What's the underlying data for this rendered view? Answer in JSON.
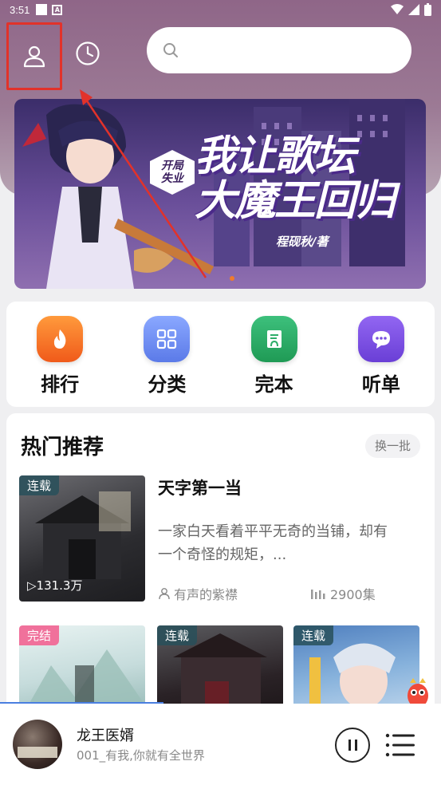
{
  "status_bar": {
    "time": "3:51"
  },
  "header": {
    "user_icon": "user-icon",
    "history_icon": "clock-icon",
    "search": {
      "placeholder": "",
      "icon": "search-icon"
    }
  },
  "banner": {
    "tag": "开局\n失业",
    "title": "我让歌坛\n大魔王回归",
    "author": "程砚秋/著",
    "active_dot": 1
  },
  "menu": {
    "items": [
      {
        "label": "排行",
        "icon": "flame-icon",
        "color": "#f47a26"
      },
      {
        "label": "分类",
        "icon": "grid-icon",
        "color": "#6f8ff0"
      },
      {
        "label": "完本",
        "icon": "book-headphones-icon",
        "color": "#2fae6a"
      },
      {
        "label": "听单",
        "icon": "chat-bubble-icon",
        "color": "#7a4fe0"
      }
    ]
  },
  "hot": {
    "title": "热门推荐",
    "swap_label": "换一批",
    "featured": {
      "tag": "连载",
      "plays": "▷131.3万",
      "title": "天字第一当",
      "description": "一家白天看着平平无奇的当铺，却有一个奇怪的规矩，...",
      "author": "有声的紫襟",
      "episodes": "2900集"
    },
    "more": [
      {
        "tag": "完结"
      },
      {
        "tag": "连载"
      },
      {
        "tag": "连载"
      }
    ]
  },
  "player": {
    "title": "龙王医婿",
    "subtitle": "001_有我,你就有全世界",
    "progress": 0.37
  }
}
